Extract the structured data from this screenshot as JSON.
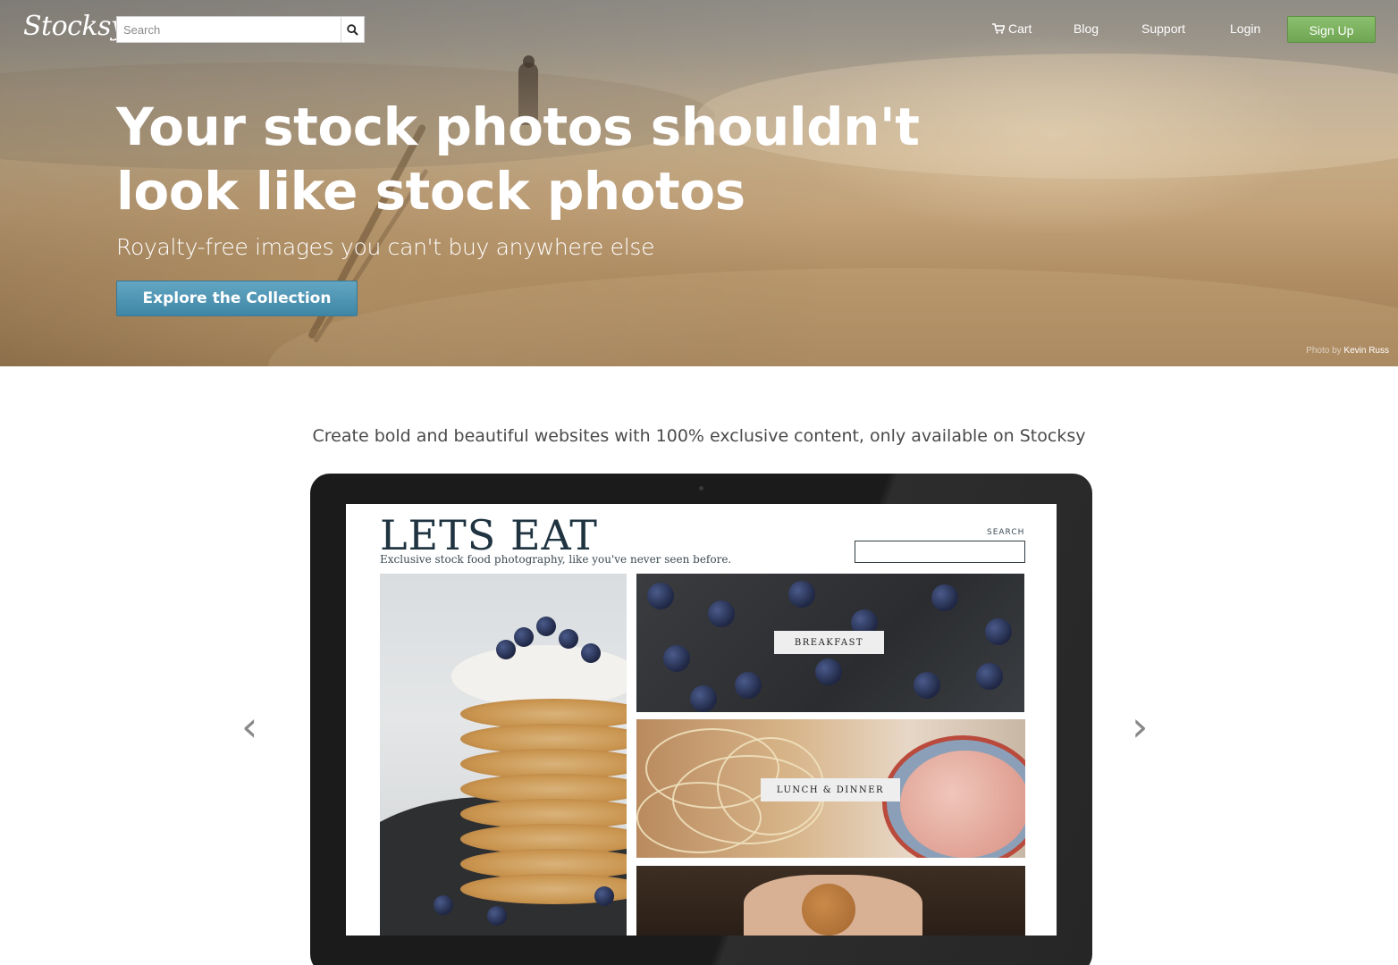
{
  "nav": {
    "logo": "Stocksy",
    "search_placeholder": "Search",
    "cart": "Cart",
    "blog": "Blog",
    "support": "Support",
    "login": "Login",
    "signup": "Sign Up"
  },
  "hero": {
    "headline_line1": "Your stock photos shouldn't",
    "headline_line2": "look like stock photos",
    "subhead": "Royalty-free images you can't buy anywhere else",
    "cta": "Explore the Collection",
    "credit_prefix": "Photo by",
    "credit_author": "Kevin Russ"
  },
  "showcase": {
    "tagline": "Create bold and beautiful websites with 100% exclusive content, only available on Stocksy",
    "prev": "‹",
    "next": "›",
    "site": {
      "title": "LETS EAT",
      "subtitle": "Exclusive stock food photography, like you've never seen before.",
      "search_label": "SEARCH",
      "categories": [
        "BREAKFAST",
        "LUNCH & DINNER"
      ]
    }
  },
  "colors": {
    "signup_green": "#7bb35e",
    "cta_blue": "#4f95b4",
    "site_title": "#1f3440"
  }
}
